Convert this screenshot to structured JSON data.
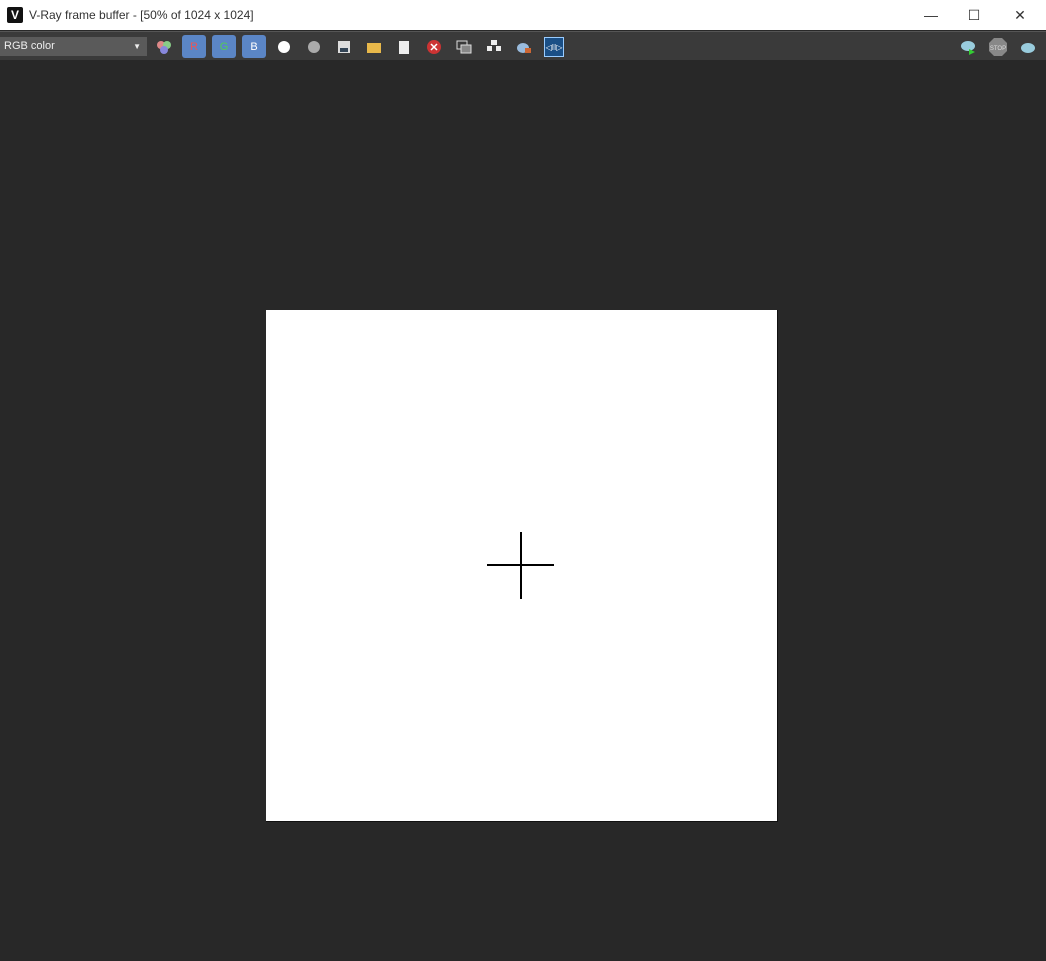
{
  "window": {
    "title": "V-Ray frame buffer - [50% of 1024 x 1024]",
    "minimize": "—",
    "maximize": "☐",
    "close": "✕"
  },
  "toolbar": {
    "channel": "RGB color",
    "red": "R",
    "green": "G",
    "blue": "B",
    "stop": "STOP"
  }
}
